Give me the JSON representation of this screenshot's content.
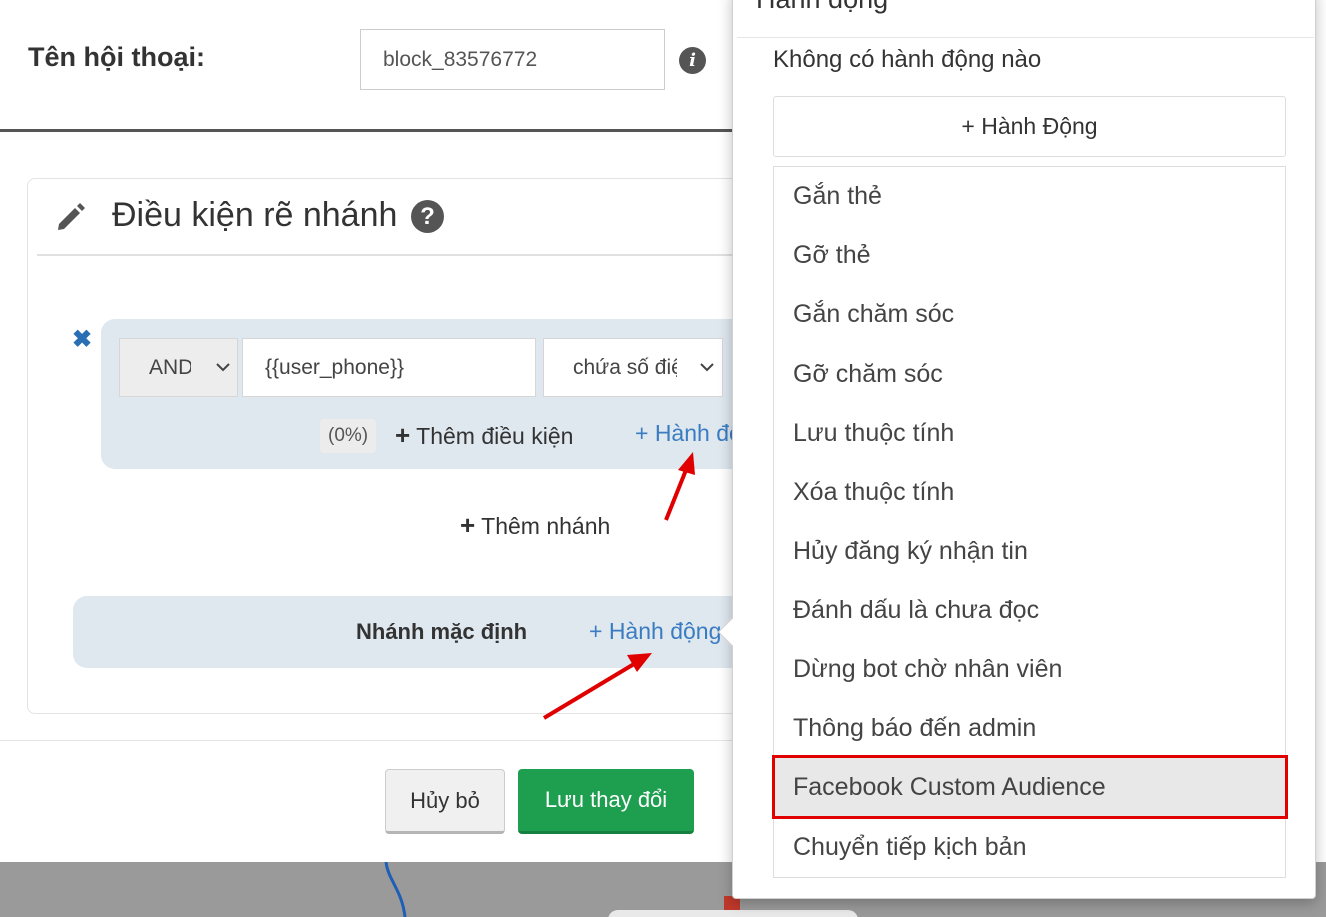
{
  "modal": {
    "name_label": "Tên hội thoại:",
    "name_value": "block_83576772"
  },
  "conditions": {
    "title": "Điều kiện rẽ nhánh",
    "branch": {
      "logic": "AND",
      "variable": "{{user_phone}}",
      "operator": "chứa số điện thoại",
      "percent": "(0%)",
      "add_condition": "Thêm điều kiện",
      "add_action": "+ Hành động"
    },
    "add_branch": "Thêm nhánh",
    "default_branch": {
      "label": "Nhánh mặc định",
      "add_action": "+ Hành động"
    }
  },
  "footer": {
    "cancel": "Hủy bỏ",
    "save": "Lưu thay đổi"
  },
  "popover": {
    "title": "Hành động",
    "empty_text": "Không có hành động nào",
    "add_button": "+ Hành Động",
    "items": [
      "Gắn thẻ",
      "Gỡ thẻ",
      "Gắn chăm sóc",
      "Gỡ chăm sóc",
      "Lưu thuộc tính",
      "Xóa thuộc tính",
      "Hủy đăng ký nhận tin",
      "Đánh dấu là chưa đọc",
      "Dừng bot chờ nhân viên",
      "Thông báo đến admin",
      "Facebook Custom Audience",
      "Chuyển tiếp kịch bản"
    ],
    "highlighted_item": "Facebook Custom Audience"
  },
  "colors": {
    "link": "#3a7cc1",
    "save_button": "#1e9e4f",
    "highlight_border": "#e00000",
    "annotation_arrow": "#e00000"
  }
}
